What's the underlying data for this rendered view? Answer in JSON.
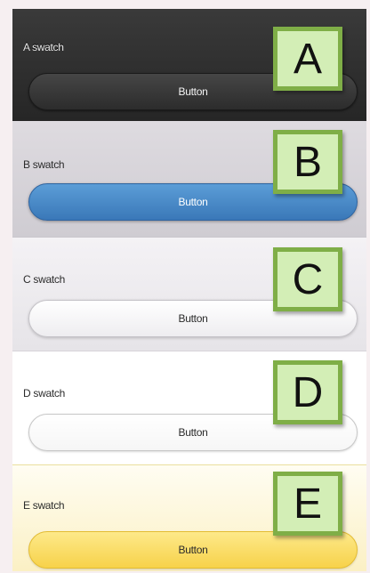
{
  "swatches": [
    {
      "id": "A",
      "title": "A swatch",
      "button_label": "Button"
    },
    {
      "id": "B",
      "title": "B swatch",
      "button_label": "Button"
    },
    {
      "id": "C",
      "title": "C swatch",
      "button_label": "Button"
    },
    {
      "id": "D",
      "title": "D swatch",
      "button_label": "Button"
    },
    {
      "id": "E",
      "title": "E swatch",
      "button_label": "Button"
    }
  ],
  "callouts": [
    "A",
    "B",
    "C",
    "D",
    "E"
  ],
  "colors": {
    "page_background": "#f6eff1",
    "swatch_a_background": "#2e2e2e",
    "swatch_b_button": "#3f7fc0",
    "swatch_e_button": "#f9dc62",
    "callout_fill": "#d3eeb6",
    "callout_border": "#7fae47"
  }
}
